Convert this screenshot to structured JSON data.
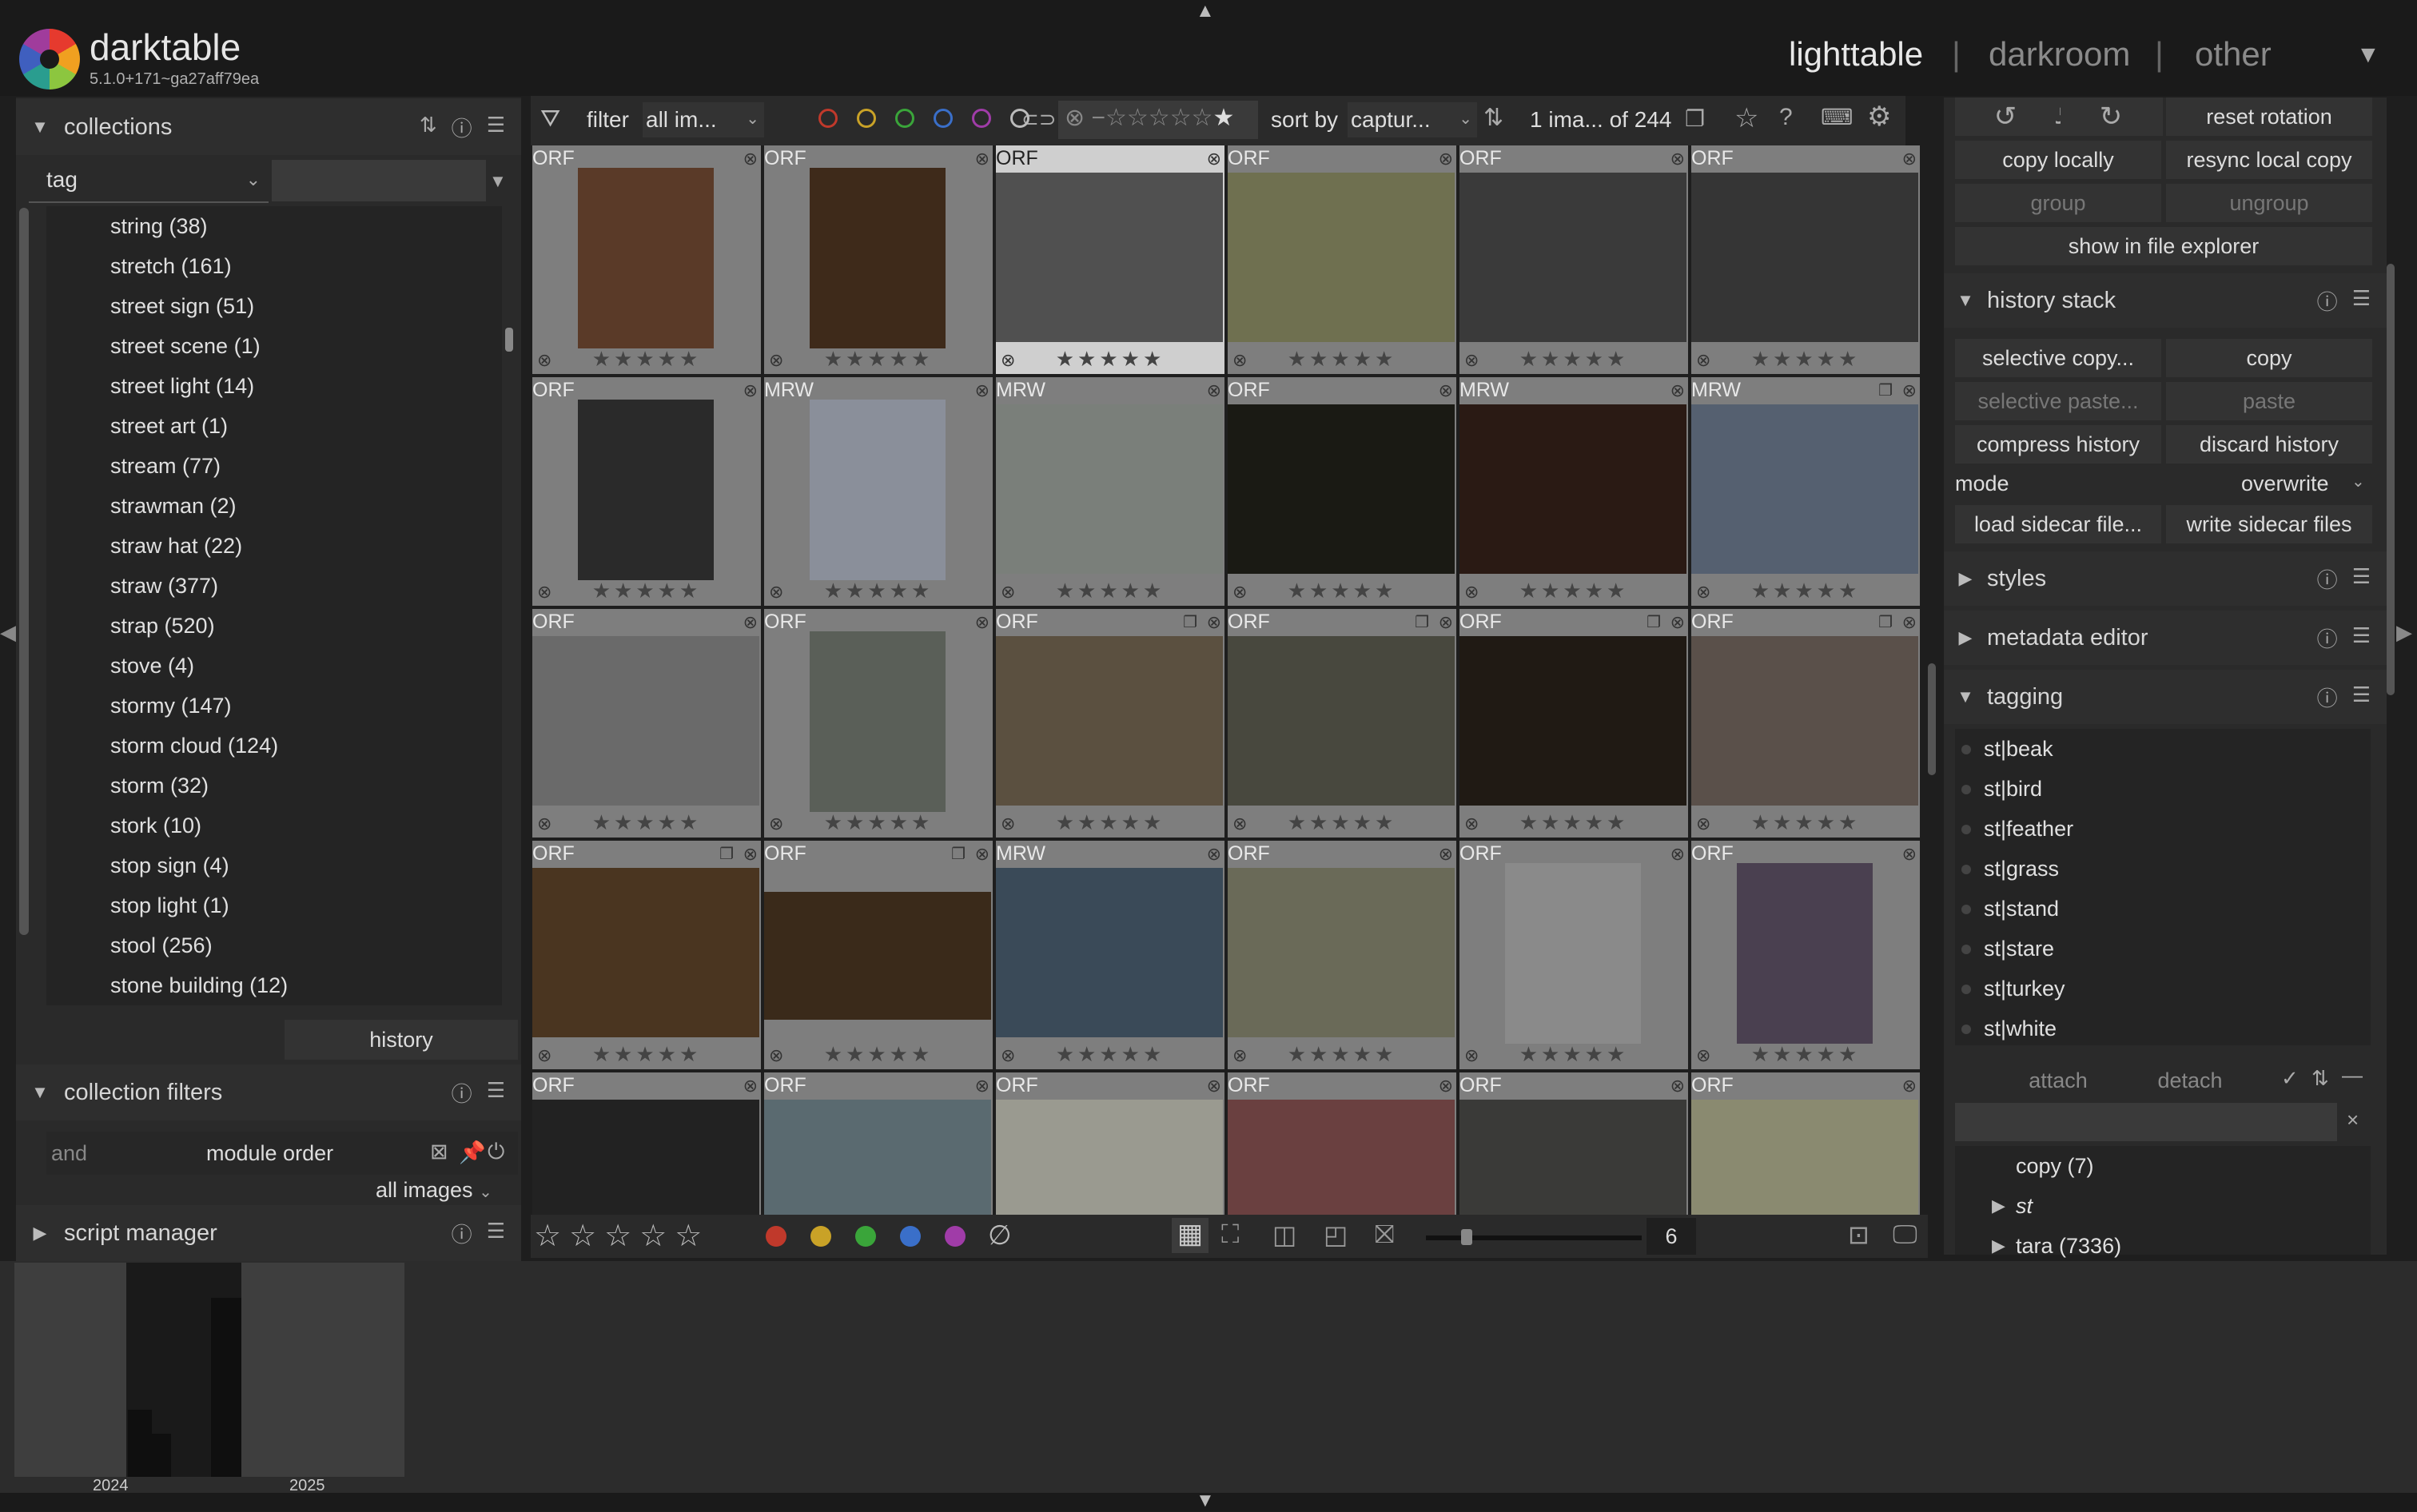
{
  "app": {
    "name": "darktable",
    "version": "5.1.0+171~ga27aff79ea"
  },
  "views": {
    "lighttable": "lighttable",
    "darkroom": "darkroom",
    "other": "other",
    "sep": "|"
  },
  "collections": {
    "title": "collections",
    "property": "tag",
    "tags": [
      "string (38)",
      "stretch (161)",
      "street sign (51)",
      "street scene (1)",
      "street light (14)",
      "street art (1)",
      "stream (77)",
      "strawman (2)",
      "straw hat (22)",
      "straw (377)",
      "strap (520)",
      "stove (4)",
      "stormy (147)",
      "storm cloud (124)",
      "storm (32)",
      "stork (10)",
      "stop sign (4)",
      "stop light (1)",
      "stool (256)",
      "stone building (12)"
    ],
    "history_label": "history"
  },
  "collection_filters": {
    "title": "collection filters",
    "op": "and",
    "module": "module order",
    "scope": "all images"
  },
  "script_manager": {
    "title": "script manager"
  },
  "topbar": {
    "filter_label": "filter",
    "filter_value": "all im...",
    "sort_label": "sort by",
    "sort_value": "captur...",
    "count": "1 ima... of 244",
    "colors": [
      "#c0392b",
      "#c9a227",
      "#3aa53a",
      "#3a6fc9",
      "#a03ca8",
      "#bbbbbb"
    ]
  },
  "grid": {
    "columns": 6,
    "cells": [
      {
        "ext": "ORF",
        "img": "#5a3a28"
      },
      {
        "ext": "ORF",
        "img": "#3e2a1a"
      },
      {
        "ext": "ORF",
        "img": "#505050",
        "selected": true
      },
      {
        "ext": "ORF",
        "img": "#6f7050"
      },
      {
        "ext": "ORF",
        "img": "#3a3a3a"
      },
      {
        "ext": "ORF",
        "img": "#353535"
      },
      {
        "ext": "ORF",
        "img": "#2a2a2a"
      },
      {
        "ext": "MRW",
        "img": "#8a8f9a"
      },
      {
        "ext": "MRW",
        "img": "#7a7f7a"
      },
      {
        "ext": "ORF",
        "img": "#1a1a14"
      },
      {
        "ext": "MRW",
        "img": "#2a1a14"
      },
      {
        "ext": "MRW",
        "img": "#556070",
        "grp": true
      },
      {
        "ext": "ORF",
        "img": "#6a6a6a"
      },
      {
        "ext": "ORF",
        "img": "#5a5f58",
        "thin": true
      },
      {
        "ext": "ORF",
        "img": "#5b5040",
        "grp": true
      },
      {
        "ext": "ORF",
        "img": "#48483e",
        "grp": true
      },
      {
        "ext": "ORF",
        "img": "#201a14",
        "grp": true
      },
      {
        "ext": "ORF",
        "img": "#5a504a",
        "grp": true
      },
      {
        "ext": "ORF",
        "img": "#4a3520",
        "grp": true
      },
      {
        "ext": "ORF",
        "img": "#3a2a1a",
        "grp": true,
        "wide": true
      },
      {
        "ext": "MRW",
        "img": "#3a4a58"
      },
      {
        "ext": "ORF",
        "img": "#6a6a58"
      },
      {
        "ext": "ORF",
        "img": "#8a8a8a",
        "thin": true
      },
      {
        "ext": "ORF",
        "img": "#4a4050",
        "thin": true
      },
      {
        "ext": "ORF",
        "img": "#222222"
      },
      {
        "ext": "ORF",
        "img": "#5a6a70"
      },
      {
        "ext": "ORF",
        "img": "#9a9a90"
      },
      {
        "ext": "ORF",
        "img": "#6a4040"
      },
      {
        "ext": "ORF",
        "img": "#3a3a38"
      },
      {
        "ext": "ORF",
        "img": "#8a8a70"
      }
    ],
    "stars": "★★★★★",
    "zoom": "6"
  },
  "right": {
    "reset_rotation": "reset rotation",
    "copy_locally": "copy locally",
    "resync": "resync local copy",
    "group": "group",
    "ungroup": "ungroup",
    "show_explorer": "show in file explorer",
    "history_stack": "history stack",
    "selective_copy": "selective copy...",
    "copy": "copy",
    "selective_paste": "selective paste...",
    "paste": "paste",
    "compress": "compress history",
    "discard": "discard history",
    "mode_label": "mode",
    "mode_value": "overwrite",
    "load_sidecar": "load sidecar file...",
    "write_sidecar": "write sidecar files",
    "styles": "styles",
    "metadata_editor": "metadata editor",
    "tagging": "tagging",
    "attached_tags": [
      "st|beak",
      "st|bird",
      "st|feather",
      "st|grass",
      "st|stand",
      "st|stare",
      "st|turkey",
      "st|white"
    ],
    "attach": "attach",
    "detach": "detach",
    "dict": [
      {
        "label": "copy (7)",
        "arrow": ""
      },
      {
        "label": "st",
        "arrow": "▶"
      },
      {
        "label": "tara (7336)",
        "arrow": "▶"
      }
    ]
  },
  "timeline": {
    "years": [
      "2024",
      "2025"
    ]
  }
}
